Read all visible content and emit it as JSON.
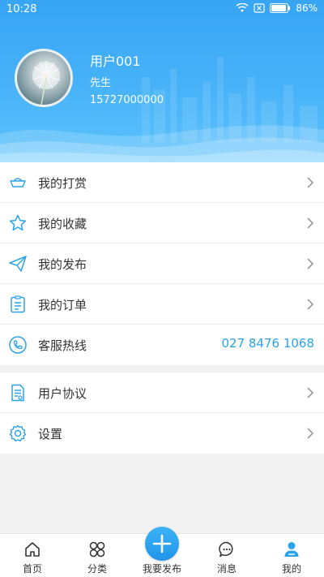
{
  "status_bar": {
    "time": "10:28",
    "battery_pct": "86%"
  },
  "profile": {
    "name": "用户001",
    "title": "先生",
    "phone": "15727000000"
  },
  "menu": {
    "reward": "我的打赏",
    "favorites": "我的收藏",
    "posts": "我的发布",
    "orders": "我的订单",
    "hotline_label": "客服热线",
    "hotline_number": "027 8476 1068",
    "agreement": "用户协议",
    "settings": "设置"
  },
  "tabbar": {
    "home": "首页",
    "category": "分类",
    "publish": "我要发布",
    "messages": "消息",
    "mine": "我的"
  },
  "colors": {
    "accent": "#2aa3e8",
    "header": "#44b0f8"
  }
}
